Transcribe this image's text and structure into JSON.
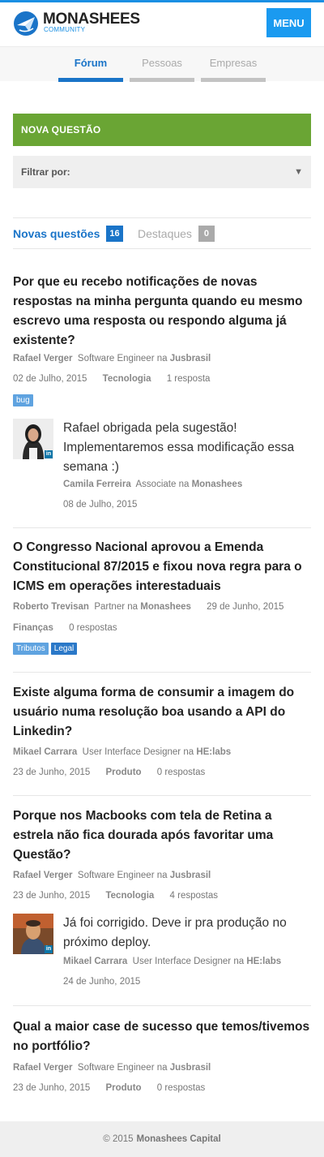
{
  "header": {
    "brand_name": "MONASHEES",
    "brand_subtitle": "COMMUNITY",
    "menu_label": "MENU"
  },
  "nav": {
    "tabs": [
      {
        "label": "Fórum",
        "active": true
      },
      {
        "label": "Pessoas",
        "active": false
      },
      {
        "label": "Empresas",
        "active": false
      }
    ]
  },
  "actions": {
    "new_question_label": "NOVA QUESTÃO",
    "filter_label": "Filtrar por:"
  },
  "question_tabs": [
    {
      "label": "Novas questões",
      "count": "16",
      "active": true
    },
    {
      "label": "Destaques",
      "count": "0",
      "active": false
    }
  ],
  "colors": {
    "accent": "#1a74c8",
    "menu": "#1a9af0",
    "new_question": "#6aa534",
    "tag_light": "#5fa3e0",
    "tag_dark": "#2a78c8"
  },
  "questions": [
    {
      "title": "Por que eu recebo notificações de novas respostas na minha pergunta quando eu mesmo escrevo uma resposta ou respondo alguma já existente?",
      "author": "Rafael Verger",
      "role": "Software Engineer",
      "connector": "na",
      "company": "Jusbrasil",
      "date": "02 de Julho, 2015",
      "category": "Tecnologia",
      "answers": "1 resposta",
      "tags": [
        "bug"
      ],
      "answer": {
        "text": "Rafael obrigada pela sugestão! Implementaremos essa modificação essa semana :)",
        "author": "Camila Ferreira",
        "role": "Associate",
        "connector": "na",
        "company": "Monashees",
        "date": "08 de Julho, 2015",
        "badge": "in"
      }
    },
    {
      "title": "O Congresso Nacional aprovou a Emenda Constitucional 87/2015 e fixou nova regra para o ICMS em operações interestaduais",
      "author": "Roberto Trevisan",
      "role": "Partner",
      "connector": "na",
      "company": "Monashees",
      "date": "29 de Junho, 2015",
      "category": "Finanças",
      "answers": "0 respostas",
      "tags": [
        "Tributos",
        "Legal"
      ]
    },
    {
      "title": "Existe alguma forma de consumir a imagem do usuário numa resolução boa usando a API do Linkedin?",
      "author": "Mikael Carrara",
      "role": "User Interface Designer",
      "connector": "na",
      "company": "HE:labs",
      "date": "23 de Junho, 2015",
      "category": "Produto",
      "answers": "0 respostas"
    },
    {
      "title": "Porque nos Macbooks com tela de Retina a estrela não fica dourada após favoritar uma Questão?",
      "author": "Rafael Verger",
      "role": "Software Engineer",
      "connector": "na",
      "company": "Jusbrasil",
      "date": "23 de Junho, 2015",
      "category": "Tecnologia",
      "answers": "4 respostas",
      "answer": {
        "text": "Já foi corrigido. Deve ir pra produção no próximo deploy.",
        "author": "Mikael Carrara",
        "role": "User Interface Designer",
        "connector": "na",
        "company": "HE:labs",
        "date": "24 de Junho, 2015",
        "badge": "in"
      }
    },
    {
      "title": "Qual a maior case de sucesso que temos/tivemos no portfólio?",
      "author": "Rafael Verger",
      "role": "Software Engineer",
      "connector": "na",
      "company": "Jusbrasil",
      "date": "23 de Junho, 2015",
      "category": "Produto",
      "answers": "0 respostas"
    }
  ],
  "footer": {
    "copyright": "© 2015",
    "company": "Monashees Capital"
  }
}
